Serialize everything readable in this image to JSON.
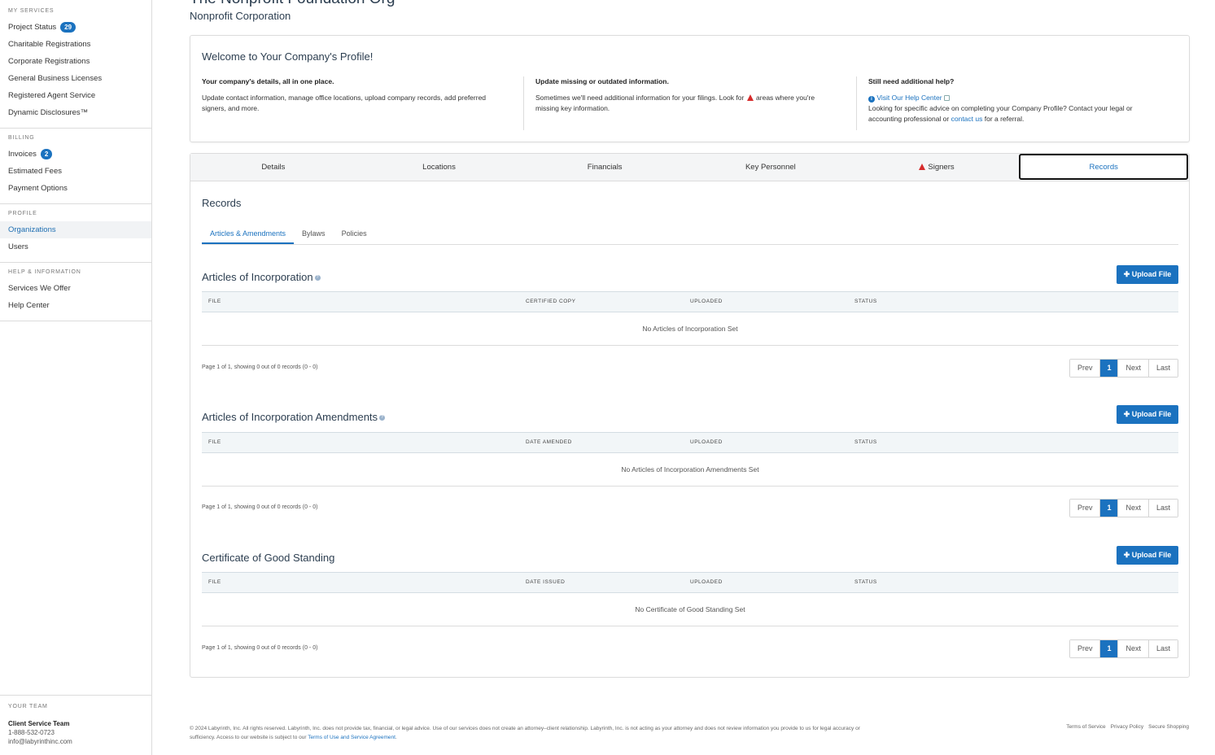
{
  "sidebar": {
    "sections": [
      {
        "heading": "MY SERVICES",
        "items": [
          {
            "label": "Project Status",
            "badge": "29"
          },
          {
            "label": "Charitable Registrations"
          },
          {
            "label": "Corporate Registrations"
          },
          {
            "label": "General Business Licenses"
          },
          {
            "label": "Registered Agent Service"
          },
          {
            "label": "Dynamic Disclosures™"
          }
        ]
      },
      {
        "heading": "BILLING",
        "items": [
          {
            "label": "Invoices",
            "badge": "2"
          },
          {
            "label": "Estimated Fees"
          },
          {
            "label": "Payment Options"
          }
        ]
      },
      {
        "heading": "PROFILE",
        "items": [
          {
            "label": "Organizations",
            "active": true
          },
          {
            "label": "Users"
          }
        ]
      },
      {
        "heading": "HELP & INFORMATION",
        "items": [
          {
            "label": "Services We Offer"
          },
          {
            "label": "Help Center"
          }
        ]
      }
    ],
    "team": {
      "heading": "YOUR TEAM",
      "name": "Client Service Team",
      "phone": "1-888-532-0723",
      "email": "info@labyrinthinc.com"
    }
  },
  "org": {
    "name": "The Nonprofit Foundation Org",
    "type": "Nonprofit Corporation"
  },
  "welcome": {
    "title": "Welcome to Your Company's Profile!",
    "col1_title": "Your company's details, all in one place.",
    "col1_text": "Update contact information, manage office locations, upload company records, add preferred signers, and more.",
    "col2_title": "Update missing or outdated information.",
    "col2_text_a": "Sometimes we'll need additional information for your filings. Look for",
    "col2_text_b": "areas where you're missing key information.",
    "col3_title": "Still need additional help?",
    "col3_link": "Visit Our Help Center",
    "col3_text_a": "Looking for specific advice on completing your Company Profile? Contact your legal or accounting professional or",
    "col3_contact": "contact us",
    "col3_text_b": "for a referral."
  },
  "tabs": [
    "Details",
    "Locations",
    "Financials",
    "Key Personnel",
    "Signers",
    "Records"
  ],
  "records": {
    "title": "Records",
    "subtabs": [
      "Articles & Amendments",
      "Bylaws",
      "Policies"
    ],
    "upload_label": "Upload File",
    "sections": [
      {
        "title": "Articles of Incorporation",
        "columns": [
          "FILE",
          "CERTIFIED COPY",
          "UPLOADED",
          "STATUS"
        ],
        "empty": "No Articles of Incorporation Set",
        "page_info": "Page 1 of 1, showing 0 out of 0 records (0 - 0)"
      },
      {
        "title": "Articles of Incorporation Amendments",
        "columns": [
          "FILE",
          "DATE AMENDED",
          "UPLOADED",
          "STATUS"
        ],
        "empty": "No Articles of Incorporation Amendments Set",
        "page_info": "Page 1 of 1, showing 0 out of 0 records (0 - 0)"
      },
      {
        "title": "Certificate of Good Standing",
        "columns": [
          "FILE",
          "DATE ISSUED",
          "UPLOADED",
          "STATUS"
        ],
        "empty": "No Certificate of Good Standing Set",
        "page_info": "Page 1 of 1, showing 0 out of 0 records (0 - 0)"
      }
    ],
    "pager": [
      "Prev",
      "1",
      "Next",
      "Last"
    ]
  },
  "footer": {
    "text": "© 2024 Labyrinth, Inc. All rights reserved. Labyrinth, Inc. does not provide tax, financial, or legal advice. Use of our services does not create an attorney–client relationship. Labyrinth, Inc. is not acting as your attorney and does not review information you provide to us for legal accuracy or sufficiency. Access to our website is subject to our",
    "terms_link": "Terms of Use and Service Agreement",
    "links": [
      "Terms of Service",
      "Privacy Policy",
      "Secure Shopping"
    ]
  },
  "colors": {
    "accent": "#1b72bf",
    "warning": "#d62b2b"
  }
}
